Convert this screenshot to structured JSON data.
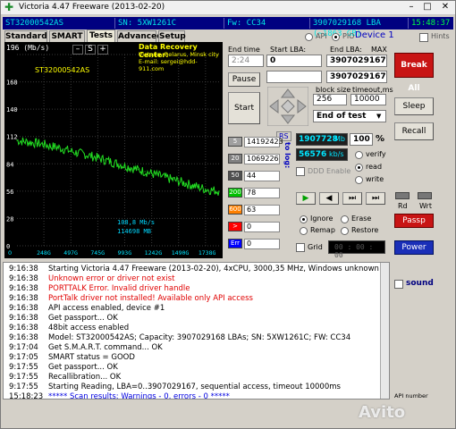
{
  "window": {
    "title": "Victoria 4.47  Freeware (2013-02-20)",
    "min": "–",
    "max": "□",
    "close": "✕"
  },
  "infobar": {
    "model": "ST32000542AS",
    "sn": "SN: 5XW1261C",
    "fw": "Fw: CC34",
    "lba": "3907029168 LBA (~1863 GB)",
    "time": "15:48:37"
  },
  "tabs": [
    {
      "label": "Standard"
    },
    {
      "label": "SMART"
    },
    {
      "label": "Tests"
    },
    {
      "label": "Advanced"
    },
    {
      "label": "Setup"
    }
  ],
  "mode": {
    "api": "API",
    "pio": "PIO",
    "device": "Device 1",
    "hints": "Hints"
  },
  "graph": {
    "ylabel_top": "196 (Mb/s)",
    "minus": "–",
    "s": "S",
    "plus": "+",
    "banner_title": "Data Recovery Center:",
    "banner_line2": "Victoria, Belarus, Minsk city",
    "banner_line3": "E-mail: sergei@hdd-911.com",
    "drive_label": "ST32000542AS",
    "speed1": "108,8 Mb/s",
    "speed2": "114698 MB",
    "yticks": [
      "196 (Mb/s)",
      "168",
      "140",
      "112",
      "84",
      "56",
      "28",
      "0"
    ],
    "xticks": [
      "248G",
      "497G",
      "745G",
      "993G",
      "1242G",
      "1490G",
      "1738G"
    ]
  },
  "controls": {
    "end_time_label": "End time",
    "end_time_value": "2:24",
    "start_lba_label": "Start LBA:",
    "start_lba_value": "0",
    "end_lba_label": "End LBA:",
    "end_lba_max": "MAX",
    "end_lba_value": "3907029167",
    "end_lba_value2": "3907029167",
    "pause": "Pause",
    "start": "Start",
    "block_size_label": "block size",
    "block_size_value": "256",
    "timeout_label": "timeout,ms",
    "timeout_value": "10000",
    "end_of_test": "End of test",
    "break_all": "Break All",
    "sleep": "Sleep",
    "recall": "Recall",
    "passp": "Passp",
    "power": "Power",
    "rd": "Rd",
    "wrt": "Wrt",
    "sound": "sound",
    "api_number": "API number"
  },
  "stats": {
    "rs": "RS",
    "to_log": "to log:",
    "rows": [
      {
        "ms": "5",
        "count": "14192423",
        "color": "#a0a0a0"
      },
      {
        "ms": "20",
        "count": "1069226",
        "color": "#808080"
      },
      {
        "ms": "50",
        "count": "44",
        "color": "#505050"
      },
      {
        "ms": "200",
        "count": "78",
        "color": "#00c000"
      },
      {
        "ms": "600",
        "count": "63",
        "color": "#ff8000"
      },
      {
        "ms": ">",
        "count": "0",
        "color": "#ff0000"
      },
      {
        "ms": "Err",
        "count": "0",
        "color": "#0000ff"
      }
    ]
  },
  "readout": {
    "mb_value": "1907728",
    "mb_unit": "Mb",
    "percent": "100",
    "pct_sign": "%",
    "kbs_value": "56576",
    "kbs_unit": "kb/s",
    "ddd": "DDD Enable",
    "verify": "verify",
    "read": "read",
    "write": "write"
  },
  "actions": {
    "ignore": "Ignore",
    "erase": "Erase",
    "remap": "Remap",
    "restore": "Restore",
    "grid": "Grid",
    "grid_time": "00 : 00 : 00"
  },
  "log": [
    {
      "time": "9:16:38",
      "msg": "Starting Victoria 4.47  Freeware (2013-02-20), 4xCPU, 3000,35 MHz, Windows unknown NT found.",
      "color": "#000000"
    },
    {
      "time": "9:16:38",
      "msg": "Unknown error or driver not exist",
      "color": "#e00000"
    },
    {
      "time": "9:16:38",
      "msg": "PORTTALK Error. Invalid driver handle",
      "color": "#e00000"
    },
    {
      "time": "9:16:38",
      "msg": "PortTalk driver not installed! Available only API access",
      "color": "#e00000"
    },
    {
      "time": "9:16:38",
      "msg": "API access enabled, device #1",
      "color": "#000000"
    },
    {
      "time": "9:16:38",
      "msg": "Get passport... OK",
      "color": "#000000"
    },
    {
      "time": "9:16:38",
      "msg": "48bit access enabled",
      "color": "#000000"
    },
    {
      "time": "9:16:38",
      "msg": "Model: ST32000542AS; Capacity: 3907029168 LBAs; SN: 5XW1261C; FW: CC34",
      "color": "#000000"
    },
    {
      "time": "9:17:04",
      "msg": "Get S.M.A.R.T. command... OK",
      "color": "#000000"
    },
    {
      "time": "9:17:05",
      "msg": "SMART status = GOOD",
      "color": "#000000"
    },
    {
      "time": "9:17:55",
      "msg": "Get passport... OK",
      "color": "#000000"
    },
    {
      "time": "9:17:55",
      "msg": "Recallibration... OK",
      "color": "#000000"
    },
    {
      "time": "9:17:55",
      "msg": "Starting Reading, LBA=0..3907029167, sequential access, timeout 10000ms",
      "color": "#000000"
    },
    {
      "time": "15:18:23",
      "msg": "***** Scan results: Warnings - 0, errors - 0 *****",
      "color": "#0000e0"
    }
  ],
  "watermark": "Avito",
  "chart_data": {
    "type": "line",
    "title": "",
    "xlabel": "",
    "ylabel": "Mb/s",
    "ylim": [
      0,
      196
    ],
    "x_ticks": [
      "248G",
      "497G",
      "745G",
      "993G",
      "1242G",
      "1490G",
      "1738G"
    ],
    "series": [
      {
        "name": "",
        "x_gb": [
          0,
          60,
          124,
          186,
          248,
          310,
          372,
          434,
          497,
          560,
          621,
          683,
          745,
          807,
          869,
          931,
          993,
          1055,
          1117,
          1180,
          1242,
          1304,
          1366,
          1428,
          1490,
          1552,
          1614,
          1676,
          1738,
          1800,
          1863
        ],
        "values": [
          108,
          107,
          106,
          105,
          104,
          102,
          101,
          99,
          97,
          95,
          94,
          92,
          90,
          88,
          86,
          84,
          82,
          80,
          78,
          76,
          74,
          72,
          70,
          68,
          66,
          64,
          62,
          60,
          58,
          57,
          56
        ]
      }
    ]
  }
}
